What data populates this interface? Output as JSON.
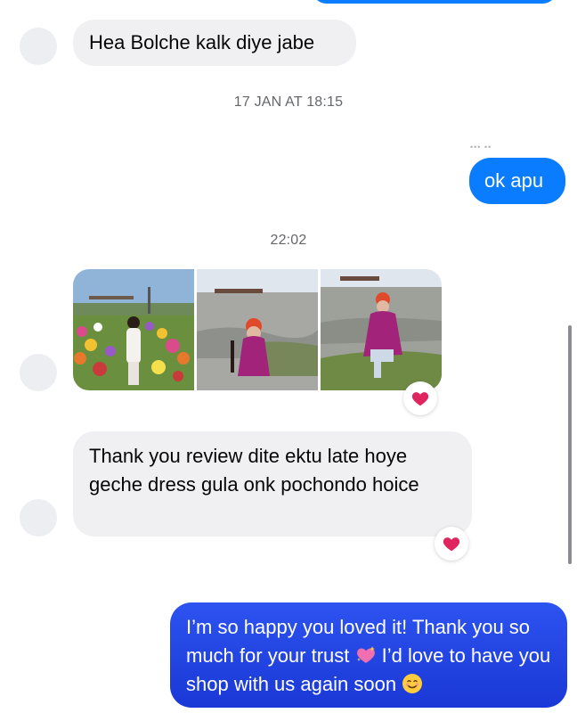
{
  "messages": {
    "m1": {
      "text": "Hea Bolche kalk diye jabe"
    },
    "t1": {
      "text": "17 JAN AT 18:15"
    },
    "m2": {
      "text": "ok apu"
    },
    "t2": {
      "text": "22:02"
    },
    "photos": [
      {
        "icon": "garden-photo"
      },
      {
        "icon": "beach-photo"
      },
      {
        "icon": "beach-sitting-photo"
      }
    ],
    "photo_reaction": "heart",
    "m3": {
      "text": "Thank you review dite ektu late hoye geche dress gula onk pochondo hoice",
      "reaction": "heart"
    },
    "m4": {
      "part1": "I’m so happy you loved it! Thank you so much for your trust",
      "part2": "I’d love to have you shop with us again soon",
      "emoji1": "sparkling-heart",
      "emoji2": "smiling-face"
    }
  },
  "colors": {
    "outgoing": "#0a7cff",
    "outgoing_dark": "#1c3fe0",
    "incoming": "#f0f0f2",
    "timestamp": "#65676b",
    "heart": "#e0245e"
  }
}
